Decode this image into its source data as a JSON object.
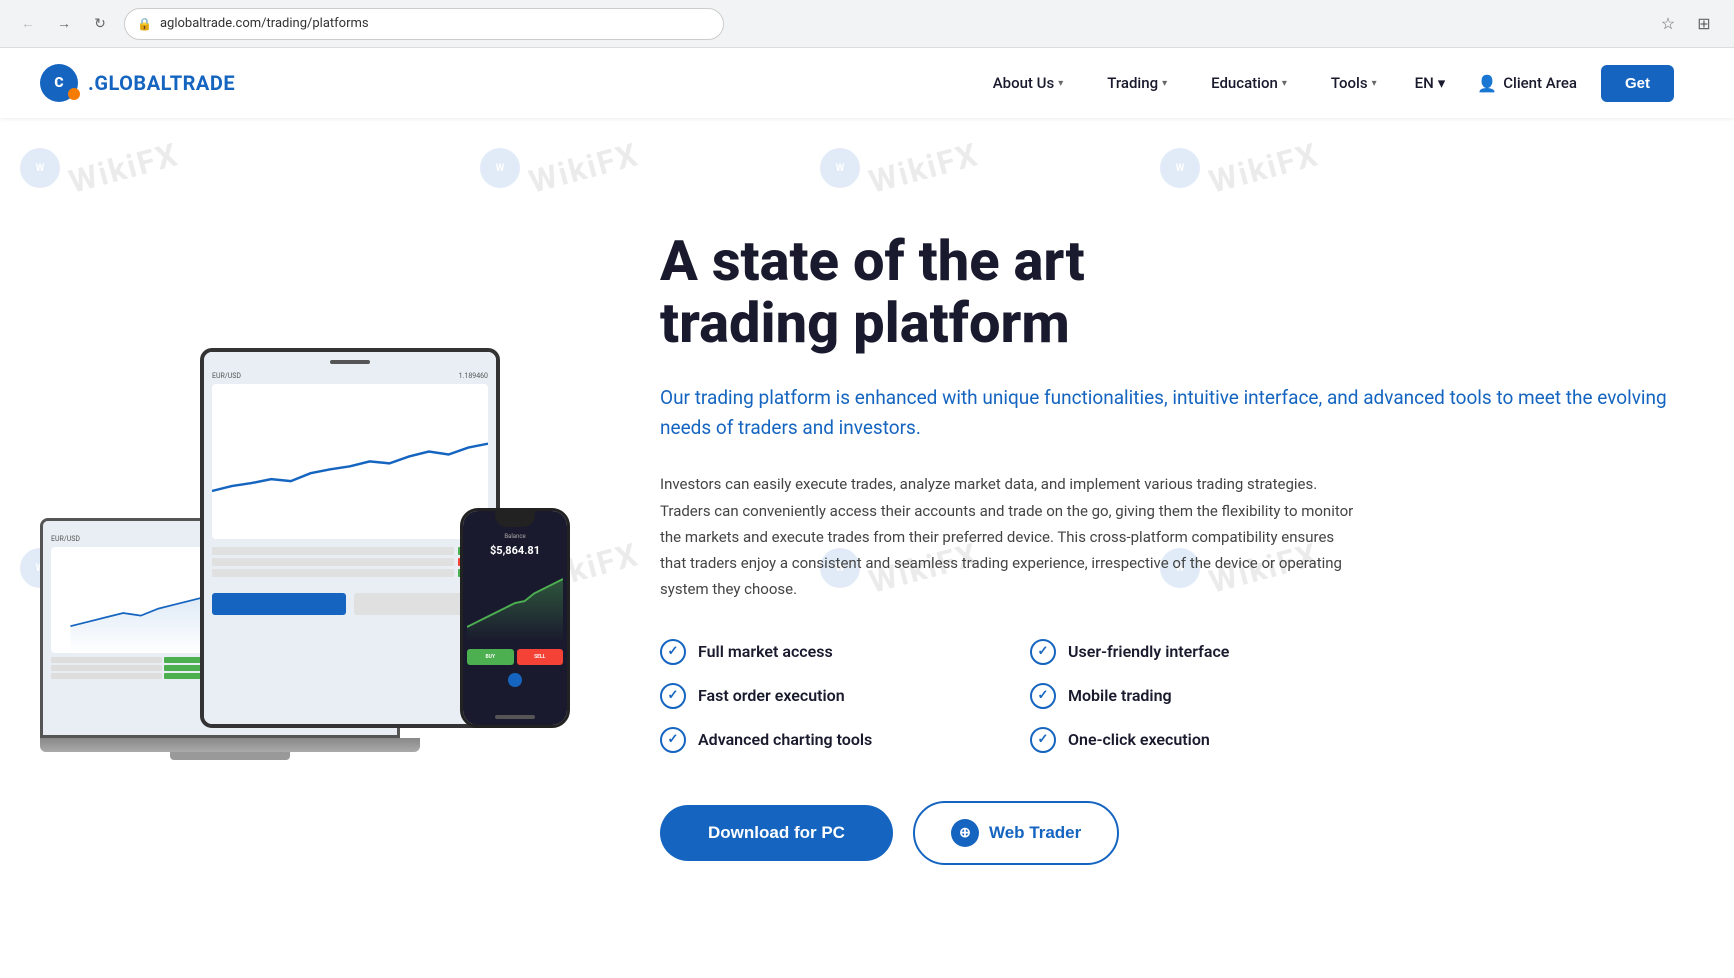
{
  "browser": {
    "url": "aglobaltrade.com/trading/platforms",
    "back_disabled": true,
    "forward_disabled": false
  },
  "navbar": {
    "logo_letter": "C",
    "logo_name": "GLOBALTRADE",
    "nav_items": [
      {
        "id": "about-us",
        "label": "About Us",
        "has_dropdown": true
      },
      {
        "id": "trading",
        "label": "Trading",
        "has_dropdown": true
      },
      {
        "id": "education",
        "label": "Education",
        "has_dropdown": true
      },
      {
        "id": "tools",
        "label": "Tools",
        "has_dropdown": true
      }
    ],
    "lang": "EN",
    "client_area": "Client Area",
    "get_started": "Get"
  },
  "hero": {
    "title_line1": "A state of the art",
    "title_line2": "trading platform",
    "subtitle": "Our trading platform is enhanced with unique functionalities, intuitive interface, and advanced tools to meet the evolving needs of traders and investors.",
    "description": "Investors can easily execute trades, analyze market data, and implement various trading strategies. Traders can conveniently access their accounts and trade on the go, giving them the flexibility to monitor the markets and execute trades from their preferred device. This cross-platform compatibility ensures that traders enjoy a consistent and seamless trading experience, irrespective of the device or operating system they choose."
  },
  "features": [
    {
      "id": "full-market-access",
      "label": "Full market access"
    },
    {
      "id": "user-friendly-interface",
      "label": "User-friendly interface"
    },
    {
      "id": "fast-order-execution",
      "label": "Fast order execution"
    },
    {
      "id": "mobile-trading",
      "label": "Mobile trading"
    },
    {
      "id": "advanced-charting-tools",
      "label": "Advanced charting tools"
    },
    {
      "id": "one-click-execution",
      "label": "One-click execution"
    }
  ],
  "cta": {
    "download_label": "Download for PC",
    "web_trader_label": "Web Trader"
  },
  "devices": {
    "currency_pair": "EUR/USD",
    "price": "1.189460",
    "balance": "$5,864.81"
  },
  "watermark": {
    "text": "WikiFX"
  }
}
